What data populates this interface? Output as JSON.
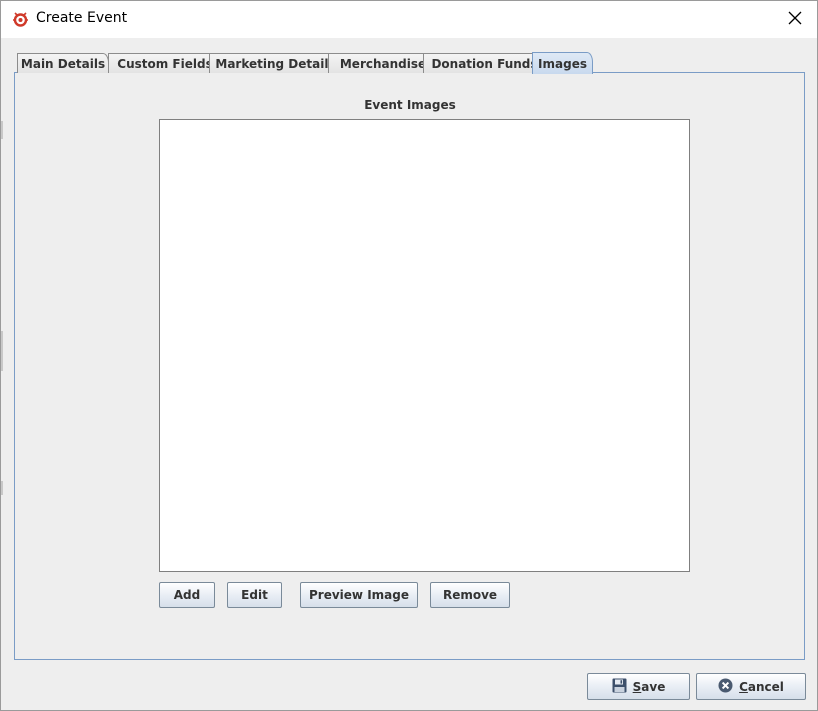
{
  "window": {
    "title": "Create Event"
  },
  "tabs": [
    {
      "label": "Main Details",
      "active": false
    },
    {
      "label": "Custom Fields",
      "active": false
    },
    {
      "label": "Marketing Details",
      "active": false
    },
    {
      "label": "Merchandise",
      "active": false
    },
    {
      "label": "Donation Funds",
      "active": false
    },
    {
      "label": "Images",
      "active": true
    }
  ],
  "images_panel": {
    "heading": "Event Images",
    "buttons": {
      "add": "Add",
      "edit": "Edit",
      "preview": "Preview Image",
      "remove": "Remove"
    }
  },
  "footer": {
    "save": {
      "mnemonic": "S",
      "rest": "ave"
    },
    "cancel": {
      "mnemonic": "C",
      "rest": "ancel"
    }
  },
  "icons": {
    "app": "app-logo-icon",
    "close": "close-icon",
    "save": "floppy-disk-icon",
    "cancel": "cancel-x-circle-icon"
  },
  "colors": {
    "accent_border": "#7a9cc6",
    "active_tab": "#c8d9ee",
    "app_icon": "#d03a2a"
  }
}
